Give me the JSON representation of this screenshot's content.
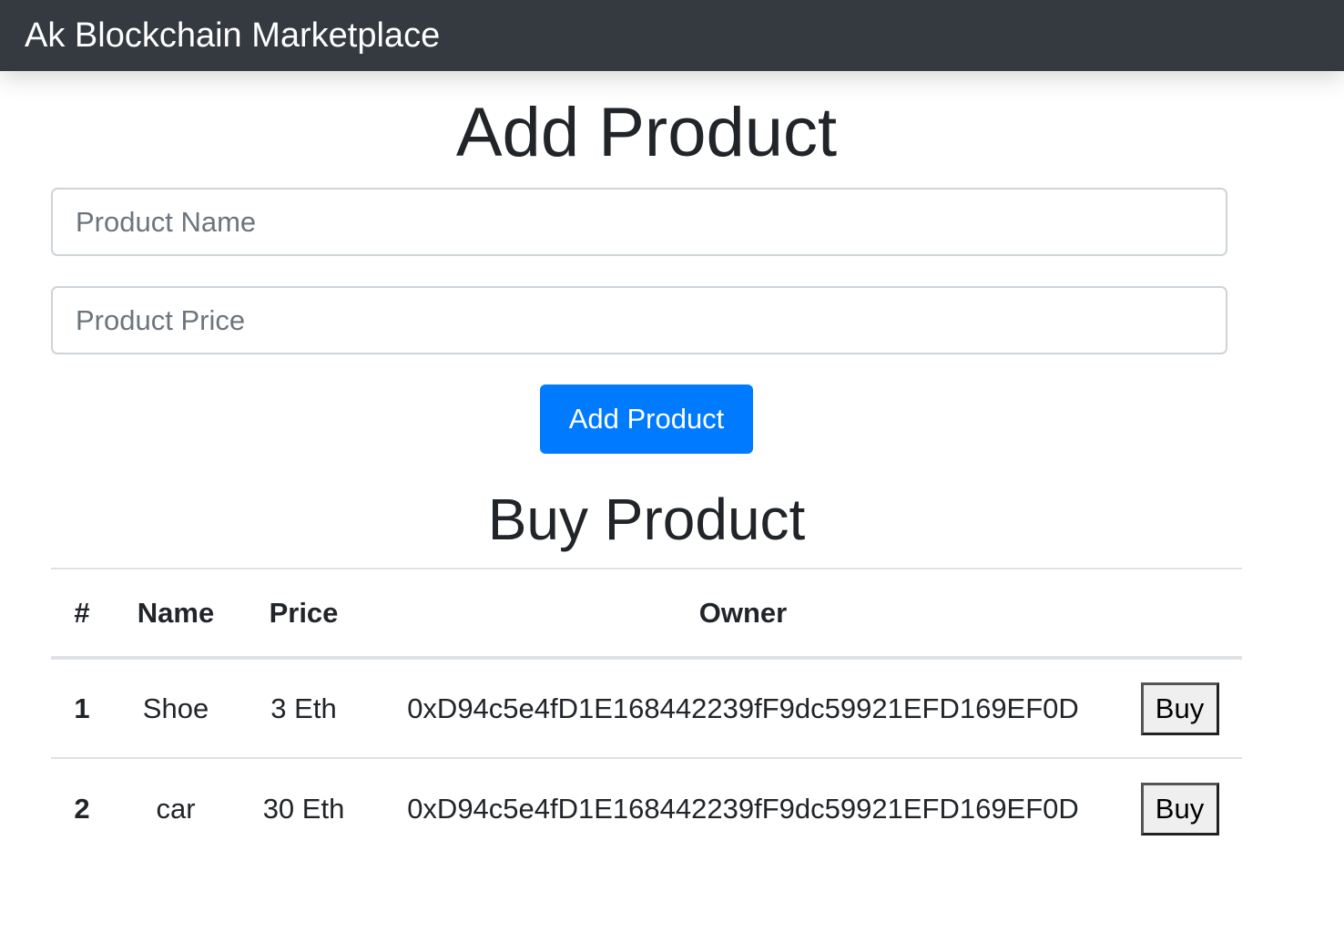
{
  "navbar": {
    "brand": "Ak Blockchain Marketplace"
  },
  "add_section": {
    "title": "Add Product",
    "name_placeholder": "Product Name",
    "name_value": "",
    "price_placeholder": "Product Price",
    "price_value": "",
    "submit_label": "Add Product"
  },
  "buy_section": {
    "title": "Buy Product",
    "columns": [
      "#",
      "Name",
      "Price",
      "Owner",
      ""
    ],
    "rows": [
      {
        "id": "1",
        "name": "Shoe",
        "price": "3 Eth",
        "owner": "0xD94c5e4fD1E168442239fF9dc59921EFD169EF0D",
        "action_label": "Buy"
      },
      {
        "id": "2",
        "name": "car",
        "price": "30 Eth",
        "owner": "0xD94c5e4fD1E168442239fF9dc59921EFD169EF0D",
        "action_label": "Buy"
      }
    ]
  },
  "colors": {
    "navbar_bg": "#343a40",
    "primary": "#007bff",
    "text": "#212529",
    "placeholder": "#6c757d",
    "border": "#dee2e6"
  }
}
